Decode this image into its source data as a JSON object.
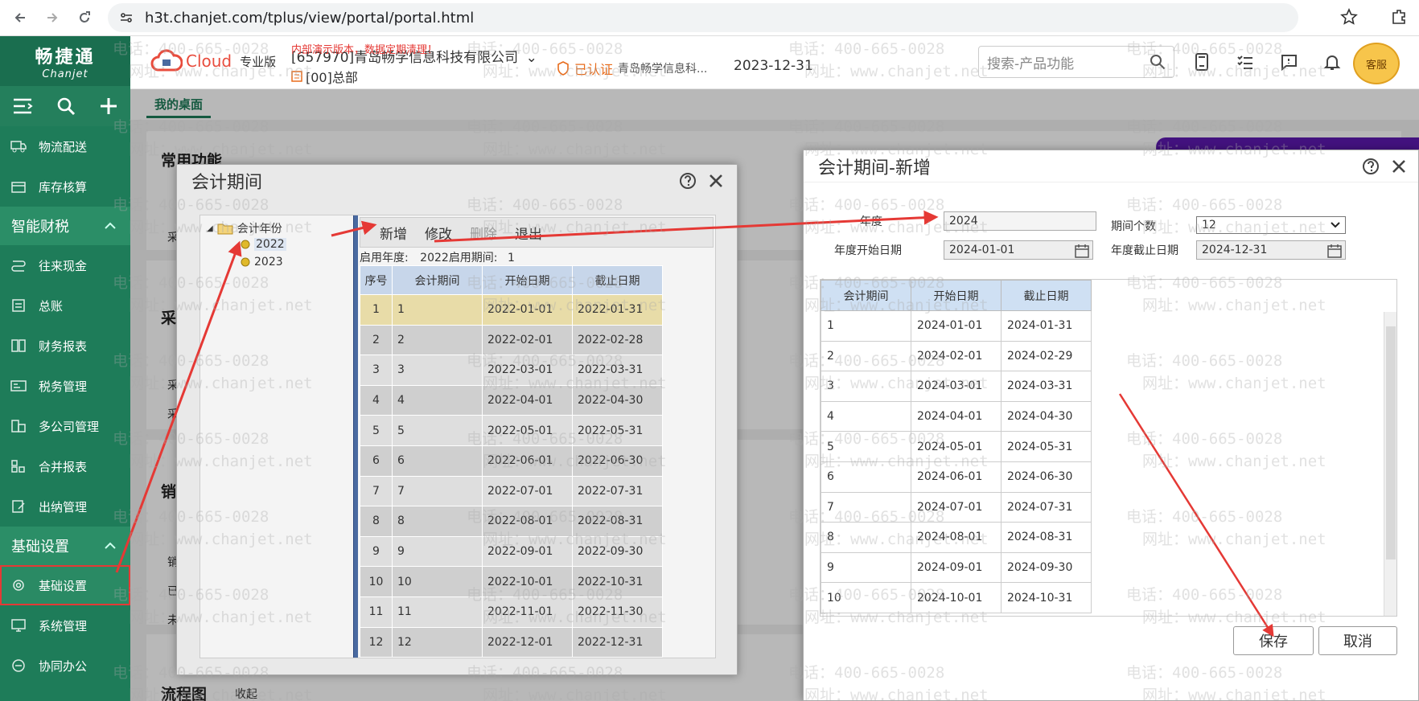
{
  "browser": {
    "url": "h3t.chanjet.com/tplus/view/portal/portal.html"
  },
  "sidebar": {
    "logo_cn": "畅捷通",
    "logo_en": "Chanjet",
    "items_top": [
      {
        "label": "物流配送",
        "icon": "truck-icon"
      },
      {
        "label": "库存核算",
        "icon": "box-icon"
      }
    ],
    "group_finance": "智能财税",
    "items_finance": [
      {
        "label": "往来现金",
        "icon": "cash-icon"
      },
      {
        "label": "总账",
        "icon": "ledger-icon"
      },
      {
        "label": "财务报表",
        "icon": "report-icon"
      },
      {
        "label": "税务管理",
        "icon": "tax-icon"
      },
      {
        "label": "多公司管理",
        "icon": "company-icon"
      },
      {
        "label": "合并报表",
        "icon": "merge-icon"
      },
      {
        "label": "出纳管理",
        "icon": "cashier-icon"
      }
    ],
    "group_basic": "基础设置",
    "items_basic": [
      {
        "label": "基础设置",
        "icon": "settings-icon"
      },
      {
        "label": "系统管理",
        "icon": "monitor-icon"
      },
      {
        "label": "协同办公",
        "icon": "collab-icon"
      }
    ]
  },
  "header": {
    "product": "Cloud",
    "edition": "专业版",
    "demo_notice": "内部演示版本，数据定期清理！",
    "company": "[657970]青岛畅学信息科技有限公司",
    "branch": "[00]总部",
    "cert_label": "已认证",
    "cert_company": "青岛畅学信息科...",
    "date": "2023-12-31",
    "search_placeholder": "搜索-产品功能",
    "avatar_label": "客服"
  },
  "tabs": {
    "desk": "我的桌面"
  },
  "desktop": {
    "common_title": "常用功能",
    "section_purchase": "采",
    "section_sales": "销",
    "flow_title": "流程图",
    "collapse": "收起",
    "frag_1": "采",
    "frag_2": "采",
    "frag_3": "采",
    "frag_4": "销",
    "frag_5": "已",
    "frag_6": "未"
  },
  "watermark": {
    "phone": "电话：400-665-0028",
    "site": "网址：www.chanjet.net"
  },
  "dialog1": {
    "title": "会计期间",
    "tree_root": "会计年份",
    "years": [
      "2022",
      "2023"
    ],
    "toolbar": {
      "add": "新增",
      "edit": "修改",
      "delete": "删除",
      "exit": "退出"
    },
    "start_year_label": "启用年度:",
    "start_year": "2022",
    "start_period_label": "启用期间:",
    "start_period": "1",
    "columns": [
      "序号",
      "会计期间",
      "开始日期",
      "截止日期"
    ],
    "rows": [
      [
        "1",
        "1",
        "2022-01-01",
        "2022-01-31"
      ],
      [
        "2",
        "2",
        "2022-02-01",
        "2022-02-28"
      ],
      [
        "3",
        "3",
        "2022-03-01",
        "2022-03-31"
      ],
      [
        "4",
        "4",
        "2022-04-01",
        "2022-04-30"
      ],
      [
        "5",
        "5",
        "2022-05-01",
        "2022-05-31"
      ],
      [
        "6",
        "6",
        "2022-06-01",
        "2022-06-30"
      ],
      [
        "7",
        "7",
        "2022-07-01",
        "2022-07-31"
      ],
      [
        "8",
        "8",
        "2022-08-01",
        "2022-08-31"
      ],
      [
        "9",
        "9",
        "2022-09-01",
        "2022-09-30"
      ],
      [
        "10",
        "10",
        "2022-10-01",
        "2022-10-31"
      ],
      [
        "11",
        "11",
        "2022-11-01",
        "2022-11-30"
      ],
      [
        "12",
        "12",
        "2022-12-01",
        "2022-12-31"
      ]
    ]
  },
  "dialog2": {
    "title": "会计期间-新增",
    "year_label": "年度",
    "year_value": "2024",
    "period_count_label": "期间个数",
    "period_count_value": "12",
    "start_date_label": "年度开始日期",
    "start_date_value": "2024-01-01",
    "end_date_label": "年度截止日期",
    "end_date_value": "2024-12-31",
    "columns": [
      "会计期间",
      "开始日期",
      "截止日期"
    ],
    "rows": [
      [
        "1",
        "2024-01-01",
        "2024-01-31"
      ],
      [
        "2",
        "2024-02-01",
        "2024-02-29"
      ],
      [
        "3",
        "2024-03-01",
        "2024-03-31"
      ],
      [
        "4",
        "2024-04-01",
        "2024-04-30"
      ],
      [
        "5",
        "2024-05-01",
        "2024-05-31"
      ],
      [
        "6",
        "2024-06-01",
        "2024-06-30"
      ],
      [
        "7",
        "2024-07-01",
        "2024-07-31"
      ],
      [
        "8",
        "2024-08-01",
        "2024-08-31"
      ],
      [
        "9",
        "2024-09-01",
        "2024-09-30"
      ],
      [
        "10",
        "2024-10-01",
        "2024-10-31"
      ]
    ],
    "save": "保存",
    "cancel": "取消"
  },
  "colors": {
    "brand_green": "#1e7c59",
    "annotation_red": "#e53935",
    "row_selected": "#e8dca8",
    "header_blue": "#c7d6ea"
  }
}
